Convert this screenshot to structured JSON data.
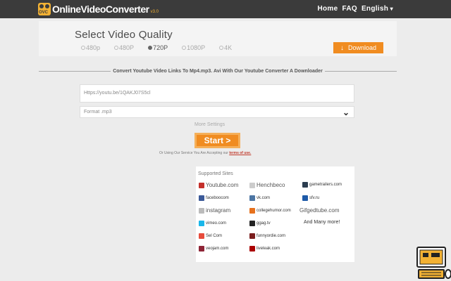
{
  "header": {
    "logo_badge": "OVC",
    "logo_text": "OnlineVideoConverter",
    "logo_version": "v3.0",
    "nav": [
      "Home",
      "FAQ",
      "English"
    ]
  },
  "quality": {
    "title": "Select Video Quality",
    "options": [
      "480p",
      "480P",
      "720P",
      "1080P",
      "4K"
    ],
    "selected_index": 2,
    "download_label": "Download"
  },
  "divider_text": "Convert Youtube Video Links To Mp4.mp3. Avi With Our Youtube Converter A Downloader",
  "url_input": {
    "value": "Https://youtu.be/1QAKJ07S5cl"
  },
  "format_select": {
    "value": "Format .mp3"
  },
  "more_settings": "More Settings",
  "start_label": "Start >",
  "terms": {
    "prefix": "Or Using Our Service You Are Accepting our",
    "link": "terms of use."
  },
  "supported": {
    "title": "Supported Sites",
    "col1": [
      "Youtube.com",
      "faceboocom",
      "instagram",
      "vimeo.com",
      "Sel Com",
      "veojam.com"
    ],
    "col2": [
      "Henchbeco",
      "vk.com",
      "collegehumor.com",
      "ggag.tv",
      "funnyordie.com",
      "liveleak.com"
    ],
    "col3": [
      "gametrailers.com",
      "sfv.ru",
      "Gifgedtube.com",
      "And Many more!"
    ]
  },
  "colors": {
    "topbar": "#3b3b3b",
    "accent": "#f08c21",
    "logo": "#f2b134"
  }
}
